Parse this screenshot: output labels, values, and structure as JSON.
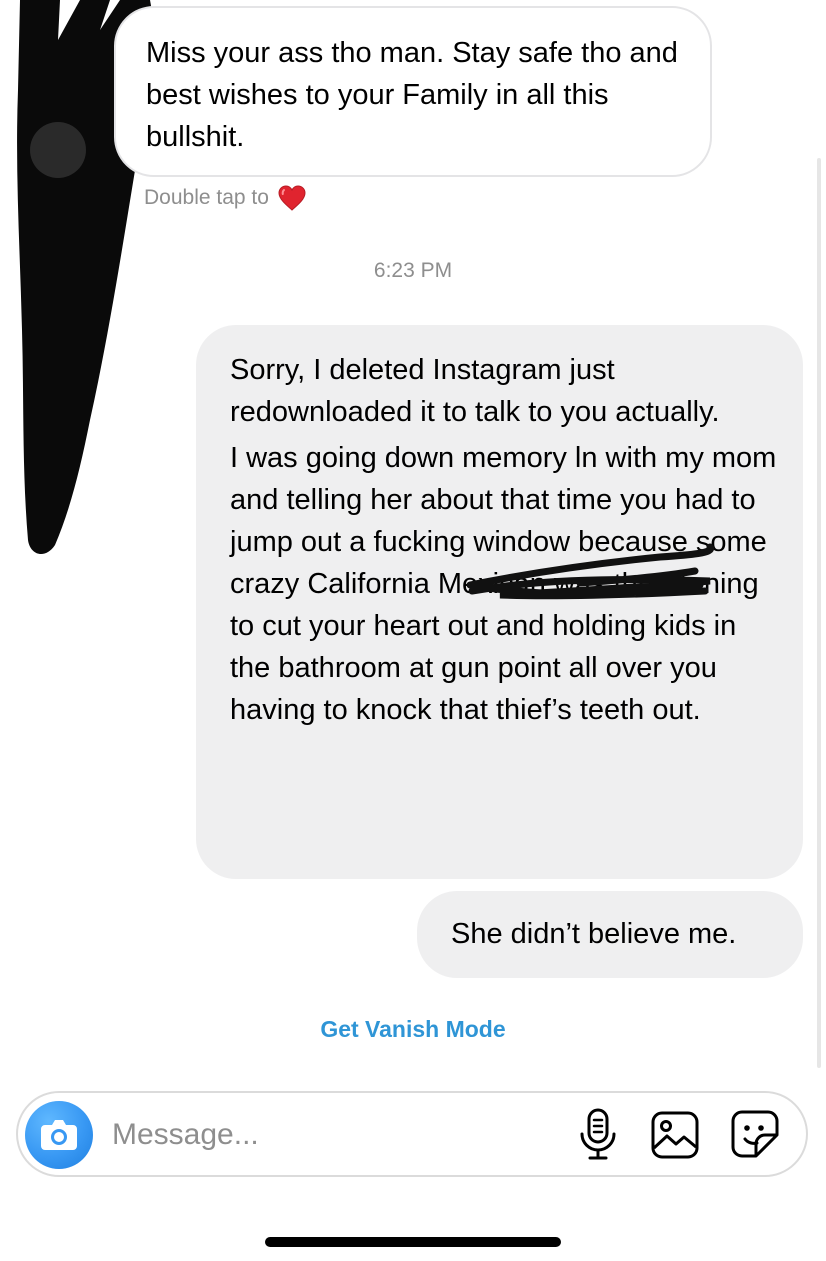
{
  "thread": {
    "received_message": {
      "text": "Miss your ass tho man. Stay safe tho and best wishes to your Family in all this bullshit.",
      "double_tap_hint": "Double tap to",
      "reaction_icon": "heart-icon",
      "reaction_color": "#e0242f"
    },
    "timestamp": "6:23 PM",
    "sent_messages": [
      {
        "paragraphs": [
          "Sorry, I deleted Instagram just redownloaded it to talk to you actually.",
          "I was going down memory ln with my mom and telling her about that time you had to jump out a fucking window because some crazy California Mexican was threatening to cut your heart out and holding kids in the bathroom at gun point all over you having to knock that thief’s teeth out."
        ]
      },
      {
        "paragraphs": [
          "She didn’t believe me."
        ]
      }
    ],
    "vanish_mode_label": "Get Vanish Mode"
  },
  "composer": {
    "placeholder": "Message...",
    "value": "",
    "camera_icon": "camera-icon",
    "tools": [
      "microphone-icon",
      "gallery-icon",
      "sticker-icon"
    ]
  },
  "colors": {
    "sent_bubble": "#efeff0",
    "received_border": "#e4e4e6",
    "meta_text": "#8e8e8e",
    "link": "#2f95d6",
    "camera_button": "#3898f3"
  }
}
